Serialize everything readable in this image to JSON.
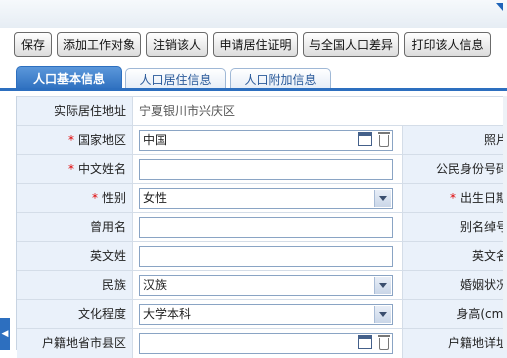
{
  "toolbar": {
    "save": "保存",
    "add_work_object": "添加工作对象",
    "cancel_person": "注销该人",
    "apply_residence_cert": "申请居住证明",
    "national_diff": "与全国人口差异",
    "print_info": "打印该人信息"
  },
  "tabs": [
    "人口基本信息",
    "人口居住信息",
    "人口附加信息"
  ],
  "form": {
    "actual_address_label": "实际居住地址",
    "actual_address_value": "宁夏银川市兴庆区",
    "country_label": "国家地区",
    "country_value": "中国",
    "photo_label": "照片",
    "chinese_name_label": "中文姓名",
    "chinese_name_value": "",
    "id_number_label": "公民身份号码",
    "gender_label": "性别",
    "gender_value": "女性",
    "birthdate_label": "出生日期",
    "former_name_label": "曾用名",
    "former_name_value": "",
    "alias_label": "别名绰号",
    "english_surname_label": "英文姓",
    "english_surname_value": "",
    "english_name_label": "英文名",
    "ethnicity_label": "民族",
    "ethnicity_value": "汉族",
    "marital_label": "婚姻状况",
    "education_label": "文化程度",
    "education_value": "大学本科",
    "height_label": "身高(cm)",
    "household_region_label": "户籍地省市县区",
    "household_region_value": "",
    "household_detail_label": "户籍地详址"
  },
  "icons": {
    "calendar": "calendar-icon",
    "delete": "trash-icon",
    "dropdown": "chevron-down-icon"
  },
  "colors": {
    "accent": "#2d6fbf",
    "label_bg": "#eaf1fa",
    "required": "#e00000"
  }
}
